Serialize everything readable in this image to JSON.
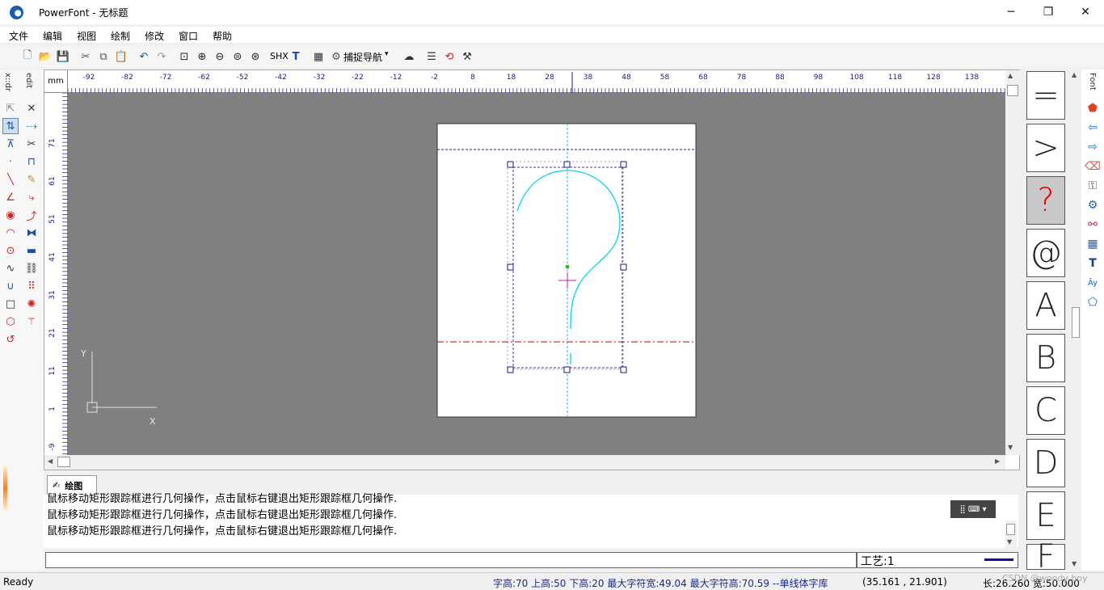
{
  "window": {
    "title": "PowerFont - 无标题",
    "minimize": "─",
    "restore": "❐",
    "close": "✕"
  },
  "menu": [
    "文件",
    "编辑",
    "视图",
    "绘制",
    "修改",
    "窗口",
    "帮助"
  ],
  "toolbar": {
    "shx_label": "SHX",
    "snap_nav_label": "捕捉导航",
    "icons": [
      "new-icon",
      "open-icon",
      "save-icon",
      "cut-icon",
      "copy-icon",
      "paste-icon",
      "undo-icon",
      "redo-icon",
      "zoom-window-icon",
      "zoom-in-icon",
      "zoom-out-icon",
      "zoom-all-icon",
      "zoom-extents-icon",
      "truetype-icon",
      "grid-icon",
      "gear-icon",
      "cloud-icon",
      "properties-icon",
      "measure-icon",
      "tools-icon"
    ]
  },
  "left_panel": {
    "tab_top": "x::dr",
    "tab_second": "edit"
  },
  "ruler": {
    "unit": "mm",
    "top_ticks": [
      "-92",
      "-82",
      "-72",
      "-62",
      "-52",
      "-42",
      "-32",
      "-22",
      "-12",
      "-2",
      "8",
      "18",
      "28",
      "38",
      "48",
      "58",
      "68",
      "78",
      "88",
      "98",
      "108",
      "118",
      "128",
      "138"
    ],
    "left_ticks": [
      "71",
      "61",
      "51",
      "41",
      "31",
      "21",
      "11",
      "1",
      "-9"
    ]
  },
  "canvas": {
    "axis_y_label": "Y",
    "axis_x_label": "X",
    "background_color": "#808080",
    "glyph_stroke_color": "#00d8f0",
    "baseline_color": "#c00000",
    "selection_color": "#4030a0"
  },
  "glyph_panel": {
    "title": "Font",
    "items": [
      {
        "char": "=",
        "selected": false
      },
      {
        "char": ">",
        "selected": false
      },
      {
        "char": "?",
        "selected": true
      },
      {
        "char": "@",
        "selected": false
      },
      {
        "char": "A",
        "selected": false
      },
      {
        "char": "B",
        "selected": false
      },
      {
        "char": "C",
        "selected": false
      },
      {
        "char": "D",
        "selected": false
      },
      {
        "char": "E",
        "selected": false
      },
      {
        "char": "F",
        "selected": false
      }
    ]
  },
  "bottom": {
    "tab_label": "绘图",
    "log_lines": [
      "鼠标移动矩形跟踪框进行几何操作，点击鼠标右键退出矩形跟踪框几何操作.",
      "鼠标移动矩形跟踪框进行几何操作，点击鼠标右键退出矩形跟踪框几何操作.",
      "鼠标移动矩形跟踪框进行几何操作，点击鼠标右键退出矩形跟踪框几何操作."
    ],
    "craft_label": "工艺:1"
  },
  "status": {
    "ready": "Ready",
    "font_metrics": "字高:70 上高:50 下高:20 最大字符宽:49.04  最大字符高:70.59  --单线体字库",
    "coords": "(35.161 , 21.901)",
    "size": "长:26.260 宽:50.000",
    "watermark": "CSDN @woody boy"
  }
}
